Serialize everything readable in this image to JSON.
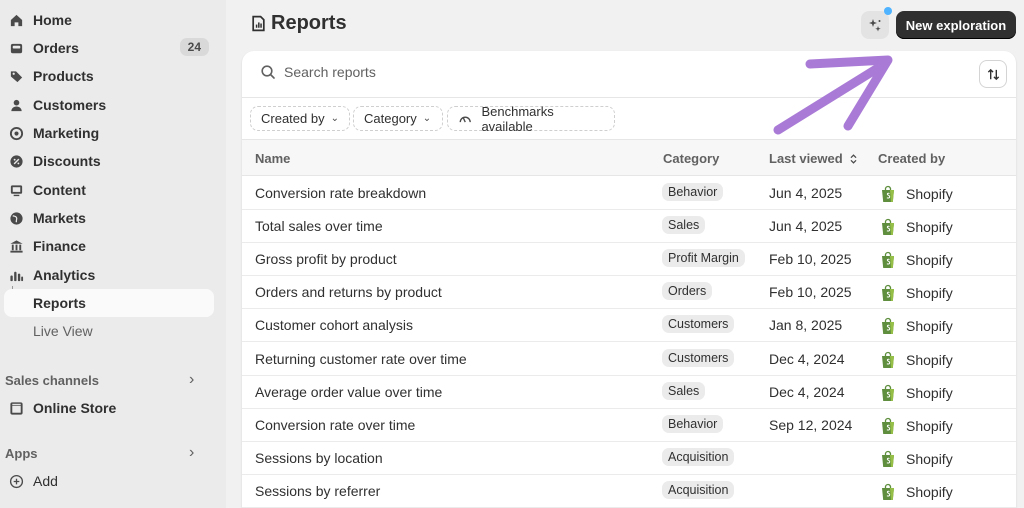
{
  "sidebar": {
    "items": [
      {
        "label": "Home"
      },
      {
        "label": "Orders",
        "badge": "24"
      },
      {
        "label": "Products"
      },
      {
        "label": "Customers"
      },
      {
        "label": "Marketing"
      },
      {
        "label": "Discounts"
      },
      {
        "label": "Content"
      },
      {
        "label": "Markets"
      },
      {
        "label": "Finance"
      },
      {
        "label": "Analytics"
      },
      {
        "label": "Reports"
      },
      {
        "label": "Live View"
      }
    ],
    "sales_channels": {
      "title": "Sales channels",
      "items": [
        {
          "label": "Online Store"
        }
      ]
    },
    "apps": {
      "title": "Apps",
      "items": [
        {
          "label": "Add"
        }
      ]
    }
  },
  "header": {
    "title": "Reports",
    "new_button": "New exploration"
  },
  "search": {
    "placeholder": "Search reports"
  },
  "filters": [
    {
      "label": "Created by"
    },
    {
      "label": "Category"
    },
    {
      "label": "Benchmarks available"
    }
  ],
  "table": {
    "columns": [
      "Name",
      "Category",
      "Last viewed",
      "Created by"
    ],
    "rows": [
      {
        "name": "Conversion rate breakdown",
        "category": "Behavior",
        "last_viewed": "Jun 4, 2025",
        "created_by": "Shopify"
      },
      {
        "name": "Total sales over time",
        "category": "Sales",
        "last_viewed": "Jun 4, 2025",
        "created_by": "Shopify"
      },
      {
        "name": "Gross profit by product",
        "category": "Profit Margin",
        "last_viewed": "Feb 10, 2025",
        "created_by": "Shopify"
      },
      {
        "name": "Orders and returns by product",
        "category": "Orders",
        "last_viewed": "Feb 10, 2025",
        "created_by": "Shopify"
      },
      {
        "name": "Customer cohort analysis",
        "category": "Customers",
        "last_viewed": "Jan 8, 2025",
        "created_by": "Shopify"
      },
      {
        "name": "Returning customer rate over time",
        "category": "Customers",
        "last_viewed": "Dec 4, 2024",
        "created_by": "Shopify"
      },
      {
        "name": "Average order value over time",
        "category": "Sales",
        "last_viewed": "Dec 4, 2024",
        "created_by": "Shopify"
      },
      {
        "name": "Conversion rate over time",
        "category": "Behavior",
        "last_viewed": "Sep 12, 2024",
        "created_by": "Shopify"
      },
      {
        "name": "Sessions by location",
        "category": "Acquisition",
        "last_viewed": "",
        "created_by": "Shopify"
      },
      {
        "name": "Sessions by referrer",
        "category": "Acquisition",
        "last_viewed": "",
        "created_by": "Shopify"
      }
    ]
  },
  "colors": {
    "accent_dark": "#303030",
    "annotation_arrow": "#a97bd6",
    "notification_dot": "#4fb3ff",
    "shopify_green": "#5e8e3e"
  }
}
